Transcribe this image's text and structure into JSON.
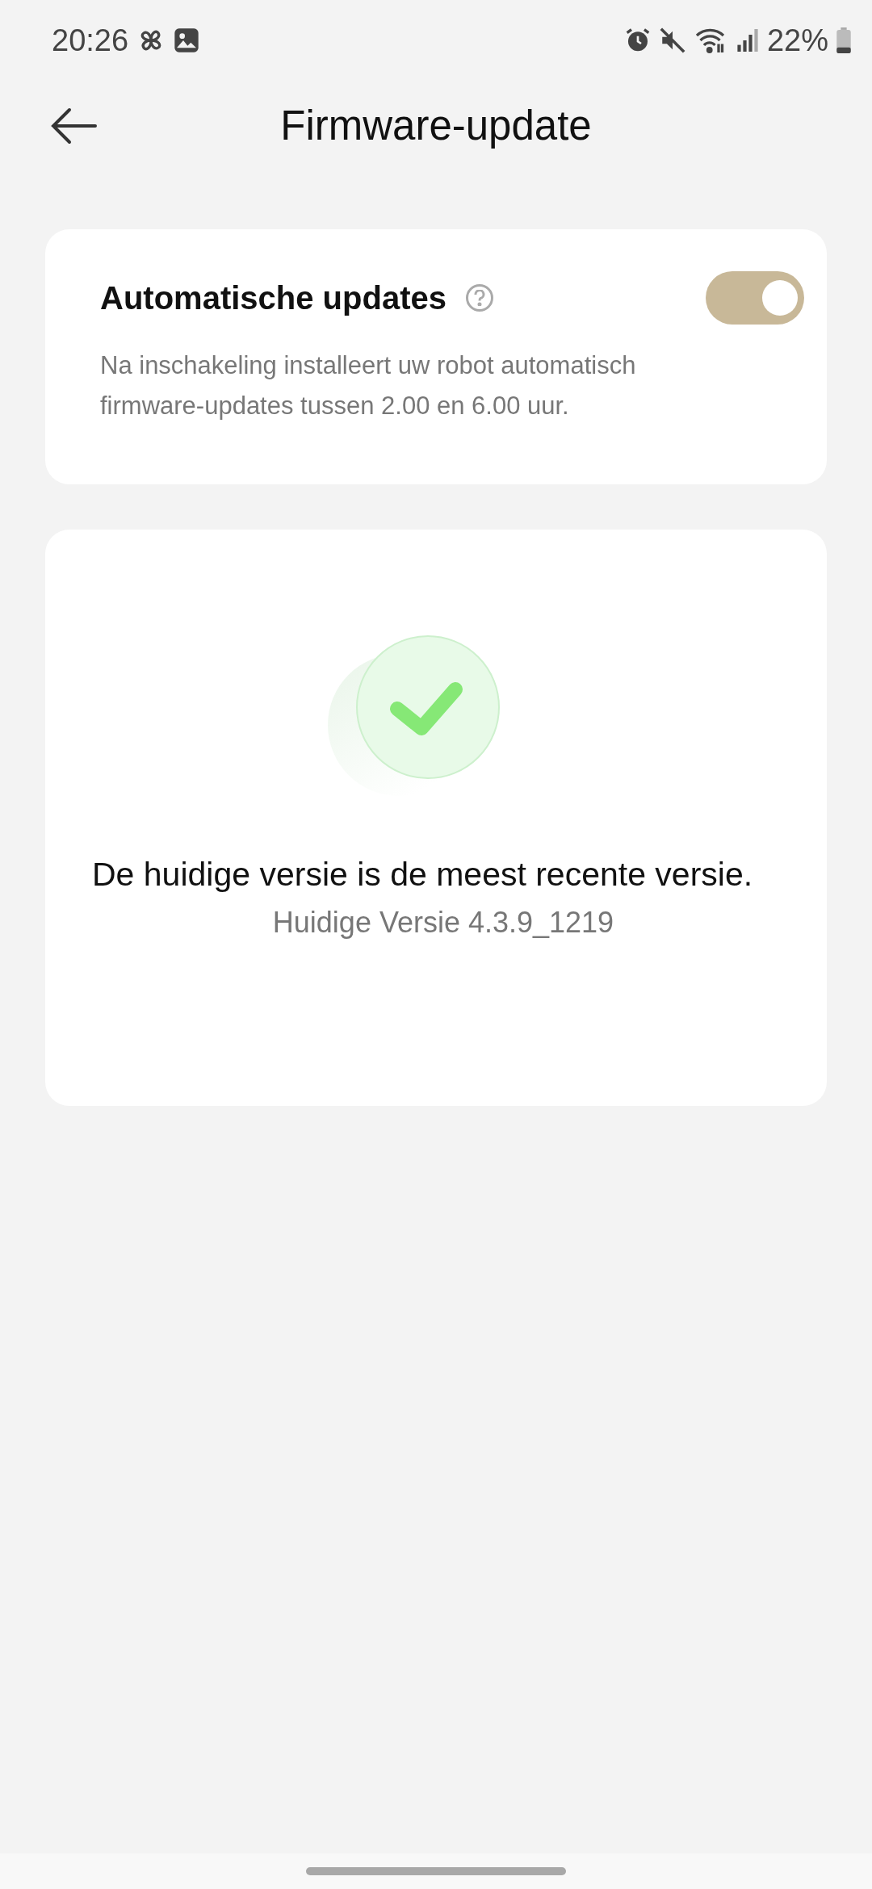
{
  "status_bar": {
    "time": "20:26",
    "battery": "22%"
  },
  "header": {
    "title": "Firmware-update"
  },
  "auto_updates": {
    "title": "Automatische updates",
    "on": true,
    "description": "Na inschakeling installeert uw robot automatisch firmware-updates tussen 2.00 en 6.00 uur."
  },
  "status": {
    "message": "De huidige versie is de meest recente versie.",
    "version": "Huidige Versie 4.3.9_1219"
  }
}
